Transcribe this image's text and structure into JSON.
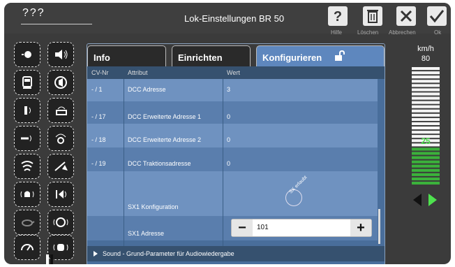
{
  "topbar": {
    "loco_name": "???",
    "title": "Lok-Einstellungen BR 50",
    "buttons": [
      {
        "label": "Hilfe",
        "icon": "help-icon"
      },
      {
        "label": "Löschen",
        "icon": "trash-icon"
      },
      {
        "label": "Abbrechen",
        "icon": "close-icon"
      },
      {
        "label": "Ok",
        "icon": "check-icon"
      }
    ]
  },
  "tabs": [
    {
      "label": "Info"
    },
    {
      "label": "Einrichten"
    },
    {
      "label": "Konfigurieren",
      "icon": "unlock-icon"
    }
  ],
  "table": {
    "headers": {
      "cv": "CV-Nr",
      "attr": "Attribut",
      "value": "Wert"
    },
    "rows": [
      {
        "cv": "- / 1",
        "attr": "DCC Adresse",
        "value": "3"
      },
      {
        "cv": "- / 17",
        "attr": "DCC Erweiterte Adresse 1",
        "value": "0"
      },
      {
        "cv": "- / 18",
        "attr": "DCC Erweiterte Adresse 2",
        "value": "0"
      },
      {
        "cv": "- / 19",
        "attr": "DCC Traktionsadresse",
        "value": "0"
      },
      {
        "cv": "",
        "attr": "SX1 Konfiguration",
        "value": ""
      },
      {
        "cv": "",
        "attr": "SX1 Adresse",
        "value": "101"
      }
    ],
    "sx_flag_label": "SX erlaubt"
  },
  "stepper": {
    "minus": "−",
    "plus": "+",
    "value": "101"
  },
  "footer": {
    "label": "Sound - Grund-Parameter für Audiowiedergabe"
  },
  "speed": {
    "unit": "km/h",
    "max": "80",
    "current": "25",
    "level": 0.31
  }
}
